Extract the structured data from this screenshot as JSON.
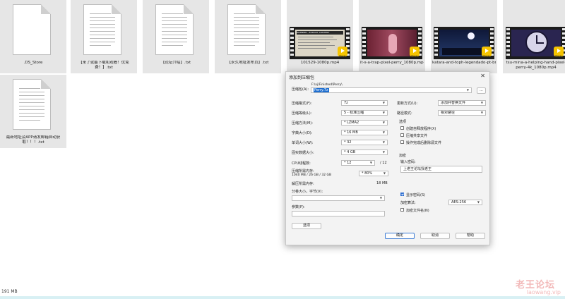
{
  "files": [
    {
      "name": ".DS_Store",
      "kind": "doc"
    },
    {
      "name": "【来了就能下载和观看！优免费！】.txt",
      "kind": "doc"
    },
    {
      "name": "【论坛介绍】.txt",
      "kind": "doc"
    },
    {
      "name": "【永久地址发布页】.txt",
      "kind": "doc"
    },
    {
      "name": "101529-1080p.mp4",
      "kind": "video",
      "tint": "#d9d4c6"
    },
    {
      "name": "it-s-a-trap-pixel-perry_1080p.mp4",
      "kind": "video",
      "tint": "#7a2a3a"
    },
    {
      "name": "katara-and-toph-legendado-pt-br_720p.mp4",
      "kind": "video",
      "tint": "#1a2a55"
    },
    {
      "name": "tsu-mina-a-helping-hand-pixel-perry-4k_1080p.mp4",
      "kind": "video",
      "tint": "#2a2550"
    },
    {
      "name": "最新地址及APP请发邮箱自动获取！！！.txt",
      "kind": "doc"
    }
  ],
  "video1_banner": "WARNING - EXPLICIT CONTENT",
  "player_badge": "Player",
  "status": {
    "size": "191 MB"
  },
  "watermark": {
    "line1": "老王论坛",
    "line2": "laowang.vip"
  },
  "dialog": {
    "title": "添加到压缩包",
    "archive_label": "压缩包(A):",
    "archive_dir": "F:\\xj\\Finished\\Perry\\",
    "archive_name": "Perry.7z",
    "browse": "...",
    "format_label": "压缩格式(F):",
    "format_value": "7z",
    "level_label": "压缩等级(L):",
    "level_value": "5 - 标准压缩",
    "method_label": "压缩方法(M):",
    "method_value": "* LZMA2",
    "dict_label": "字典大小(D):",
    "dict_value": "* 16 MB",
    "word_label": "单词大小(W):",
    "word_value": "* 32",
    "solid_label": "固实数据大小:",
    "solid_value": "* 4 GB",
    "cpu_label": "CPU线程数:",
    "cpu_value": "* 12",
    "cpu_total": "/ 12",
    "mem_label": "压缩所需内存:",
    "mem_detail": "1040 MB / 26 GB / 32 GB",
    "mem_pct": "* 80%",
    "decomp_label": "解压所需内存:",
    "decomp_value": "18 MB",
    "split_label": "分卷大小，字节(V):",
    "params_label": "参数(P):",
    "options_btn": "选项",
    "update_label": "更新方式(U):",
    "update_value": "添加并替换文件",
    "pathmode_label": "路径模式:",
    "pathmode_value": "相对路径",
    "options_title": "选项",
    "opt_sfx": "创建自释放程序(X)",
    "opt_shared": "压缩共享文件",
    "opt_delete": "操作完成后删除源文件",
    "enc_title": "加密",
    "pwd_label": "输入密码:",
    "pwd_value": "上老王论坛找老王",
    "show_pwd": "显示密码(S)",
    "enc_method_label": "加密算法:",
    "enc_method_value": "AES-256",
    "enc_names": "加密文件名(N)",
    "ok": "确定",
    "cancel": "取消",
    "help": "帮助"
  }
}
